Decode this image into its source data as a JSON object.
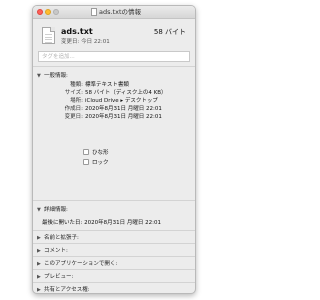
{
  "window": {
    "title": "ads.txtの情報"
  },
  "file": {
    "name": "ads.txt",
    "size": "58 バイト",
    "modified_short": "変更日: 今日 22:01"
  },
  "tags": {
    "placeholder": "タグを追加..."
  },
  "general": {
    "header": "一般情報:",
    "rows": [
      {
        "label": "種類:",
        "value": "標準テキスト書類"
      },
      {
        "label": "サイズ:",
        "value": "58 バイト（ディスク上の4 KB）"
      },
      {
        "label": "場所:",
        "value": "iCloud Drive ▸ デスクトップ"
      },
      {
        "label": "作成日:",
        "value": "2020年8月31日 月曜日 22:01"
      },
      {
        "label": "変更日:",
        "value": "2020年8月31日 月曜日 22:01"
      }
    ],
    "checkboxes": [
      {
        "label": "ひな形",
        "checked": false
      },
      {
        "label": "ロック",
        "checked": false
      }
    ]
  },
  "more_info": {
    "header": "詳細情報:",
    "last_opened": "最後に開いた日: 2020年8月31日 月曜日 22:01"
  },
  "collapsed_sections": [
    {
      "label": "名前と拡張子:"
    },
    {
      "label": "コメント:"
    },
    {
      "label": "このアプリケーションで開く:"
    },
    {
      "label": "プレビュー:"
    },
    {
      "label": "共有とアクセス権:"
    }
  ]
}
